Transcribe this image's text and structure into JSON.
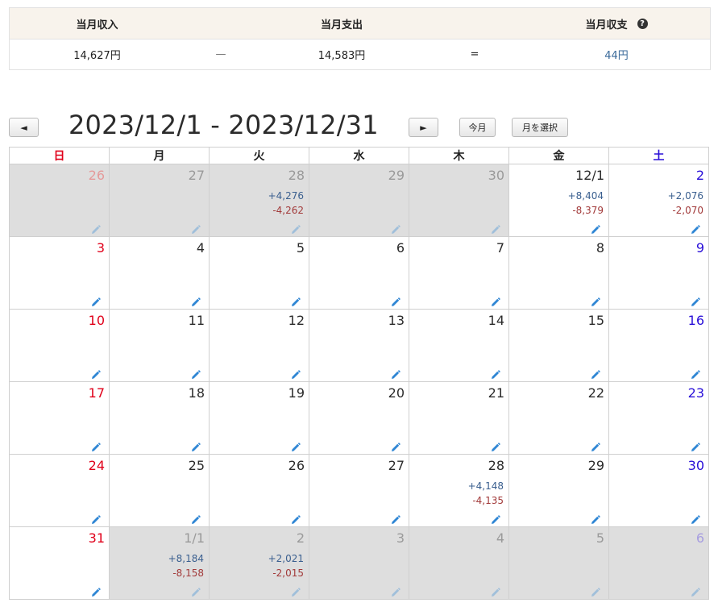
{
  "summary": {
    "income_label": "当月収入",
    "expense_label": "当月支出",
    "balance_label": "当月収支",
    "help_icon": "?",
    "income_value": "14,627円",
    "op_minus": "—",
    "expense_value": "14,583円",
    "op_equals": "=",
    "balance_value": "44円"
  },
  "nav": {
    "prev_label": "◄",
    "title": "2023/12/1 - 2023/12/31",
    "next_label": "►",
    "today_label": "今月",
    "pick_month_label": "月を選択"
  },
  "calendar": {
    "weekdays": [
      "日",
      "月",
      "火",
      "水",
      "木",
      "金",
      "土"
    ],
    "weeks": [
      [
        {
          "day": "26",
          "out": true,
          "income": "",
          "expense": ""
        },
        {
          "day": "27",
          "out": true,
          "income": "",
          "expense": ""
        },
        {
          "day": "28",
          "out": true,
          "income": "+4,276",
          "expense": "-4,262"
        },
        {
          "day": "29",
          "out": true,
          "income": "",
          "expense": ""
        },
        {
          "day": "30",
          "out": true,
          "income": "",
          "expense": ""
        },
        {
          "day": "12/1",
          "out": false,
          "income": "+8,404",
          "expense": "-8,379"
        },
        {
          "day": "2",
          "out": false,
          "income": "+2,076",
          "expense": "-2,070"
        }
      ],
      [
        {
          "day": "3",
          "out": false,
          "income": "",
          "expense": ""
        },
        {
          "day": "4",
          "out": false,
          "income": "",
          "expense": ""
        },
        {
          "day": "5",
          "out": false,
          "income": "",
          "expense": ""
        },
        {
          "day": "6",
          "out": false,
          "income": "",
          "expense": ""
        },
        {
          "day": "7",
          "out": false,
          "income": "",
          "expense": ""
        },
        {
          "day": "8",
          "out": false,
          "income": "",
          "expense": ""
        },
        {
          "day": "9",
          "out": false,
          "income": "",
          "expense": ""
        }
      ],
      [
        {
          "day": "10",
          "out": false,
          "income": "",
          "expense": ""
        },
        {
          "day": "11",
          "out": false,
          "income": "",
          "expense": ""
        },
        {
          "day": "12",
          "out": false,
          "income": "",
          "expense": ""
        },
        {
          "day": "13",
          "out": false,
          "income": "",
          "expense": ""
        },
        {
          "day": "14",
          "out": false,
          "income": "",
          "expense": ""
        },
        {
          "day": "15",
          "out": false,
          "income": "",
          "expense": ""
        },
        {
          "day": "16",
          "out": false,
          "income": "",
          "expense": ""
        }
      ],
      [
        {
          "day": "17",
          "out": false,
          "income": "",
          "expense": ""
        },
        {
          "day": "18",
          "out": false,
          "income": "",
          "expense": ""
        },
        {
          "day": "19",
          "out": false,
          "income": "",
          "expense": ""
        },
        {
          "day": "20",
          "out": false,
          "income": "",
          "expense": ""
        },
        {
          "day": "21",
          "out": false,
          "income": "",
          "expense": ""
        },
        {
          "day": "22",
          "out": false,
          "income": "",
          "expense": ""
        },
        {
          "day": "23",
          "out": false,
          "income": "",
          "expense": ""
        }
      ],
      [
        {
          "day": "24",
          "out": false,
          "income": "",
          "expense": ""
        },
        {
          "day": "25",
          "out": false,
          "income": "",
          "expense": ""
        },
        {
          "day": "26",
          "out": false,
          "income": "",
          "expense": ""
        },
        {
          "day": "27",
          "out": false,
          "income": "",
          "expense": ""
        },
        {
          "day": "28",
          "out": false,
          "income": "+4,148",
          "expense": "-4,135"
        },
        {
          "day": "29",
          "out": false,
          "income": "",
          "expense": ""
        },
        {
          "day": "30",
          "out": false,
          "income": "",
          "expense": ""
        }
      ],
      [
        {
          "day": "31",
          "out": false,
          "income": "",
          "expense": ""
        },
        {
          "day": "1/1",
          "out": true,
          "income": "+8,184",
          "expense": "-8,158"
        },
        {
          "day": "2",
          "out": true,
          "income": "+2,021",
          "expense": "-2,015"
        },
        {
          "day": "3",
          "out": true,
          "income": "",
          "expense": ""
        },
        {
          "day": "4",
          "out": true,
          "income": "",
          "expense": ""
        },
        {
          "day": "5",
          "out": true,
          "income": "",
          "expense": ""
        },
        {
          "day": "6",
          "out": true,
          "income": "",
          "expense": ""
        }
      ]
    ]
  },
  "colors": {
    "sunday": "#e0001a",
    "saturday": "#2a10d8",
    "income": "#3a5f8f",
    "expense": "#a23a3a",
    "balance": "#3a6a9a",
    "out_of_month_bg": "#dedede",
    "summary_header_bg": "#f8f3ec",
    "pencil": "#2f86d4"
  },
  "icons": {
    "cell_edit": "pencil-icon",
    "help": "question-circle-icon"
  }
}
